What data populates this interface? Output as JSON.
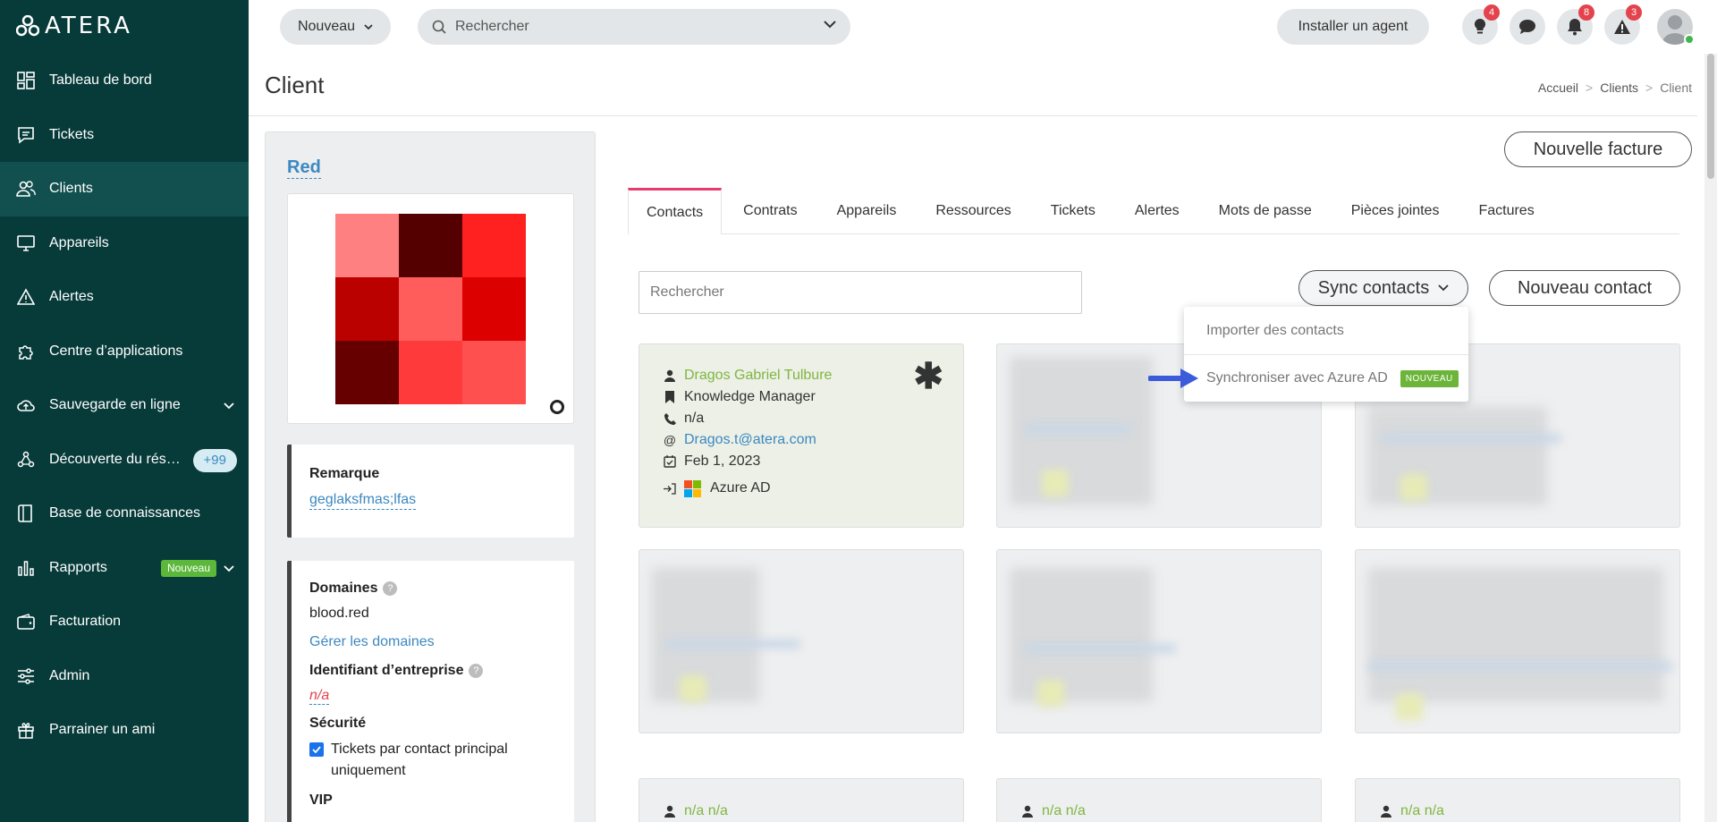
{
  "app": {
    "logo_text": "ATERA"
  },
  "sidebar": {
    "items": [
      {
        "label": "Tableau de bord",
        "icon": "dashboard-icon"
      },
      {
        "label": "Tickets",
        "icon": "ticket-icon"
      },
      {
        "label": "Clients",
        "icon": "users-icon",
        "active": true
      },
      {
        "label": "Appareils",
        "icon": "monitor-icon"
      },
      {
        "label": "Alertes",
        "icon": "alert-icon"
      },
      {
        "label": "Centre d’applications",
        "icon": "puzzle-icon"
      },
      {
        "label": "Sauvegarde en ligne",
        "icon": "cloud-icon"
      },
      {
        "label": "Découverte du rés…",
        "icon": "network-icon",
        "count": "+99"
      },
      {
        "label": "Base de connaissances",
        "icon": "book-icon"
      },
      {
        "label": "Rapports",
        "icon": "chart-icon",
        "badge": "Nouveau"
      },
      {
        "label": "Facturation",
        "icon": "wallet-icon"
      },
      {
        "label": "Admin",
        "icon": "sliders-icon"
      },
      {
        "label": "Parrainer un ami",
        "icon": "gift-icon"
      }
    ]
  },
  "topbar": {
    "new_label": "Nouveau",
    "search_placeholder": "Rechercher",
    "install_agent_label": "Installer un agent",
    "badges": {
      "lightbulb": "4",
      "notifications": "8",
      "alerts": "3"
    }
  },
  "header": {
    "title": "Client",
    "breadcrumb": [
      "Accueil",
      "Clients",
      "Client"
    ]
  },
  "client": {
    "name": "Red",
    "logo_colors": [
      "#ff8080",
      "#550000",
      "#ff2020",
      "#bb0000",
      "#ff5c5c",
      "#dd0000",
      "#660000",
      "#ff3a3a",
      "#ff5050"
    ],
    "remark_label": "Remarque",
    "remark_value": "geglaksfmas;lfas",
    "domains_label": "Domaines",
    "domain_value": "blood.red",
    "manage_domains": "Gérer les domaines",
    "company_id_label": "Identifiant d’entreprise",
    "company_id_value": "n/a",
    "security_label": "Sécurité",
    "security_option": "Tickets par contact principal uniquement",
    "vip_label": "VIP"
  },
  "main": {
    "new_invoice_label": "Nouvelle facture",
    "tabs": [
      "Contacts",
      "Contrats",
      "Appareils",
      "Ressources",
      "Tickets",
      "Alertes",
      "Mots de passe",
      "Pièces jointes",
      "Factures"
    ],
    "search_placeholder": "Rechercher",
    "sync_label": "Sync contacts",
    "new_contact_label": "Nouveau contact",
    "dropdown": {
      "import_label": "Importer des contacts",
      "sync_azure_label": "Synchroniser avec Azure AD",
      "new_badge": "NOUVEAU"
    },
    "primary_contact": {
      "name": "Dragos Gabriel Tulbure",
      "title": "Knowledge Manager",
      "phone": "n/a",
      "email": "Dragos.t@atera.com",
      "date": "Feb 1, 2023",
      "source": "Azure AD"
    },
    "bottom_contacts": [
      "n/a n/a",
      "n/a n/a",
      "n/a n/a"
    ]
  }
}
